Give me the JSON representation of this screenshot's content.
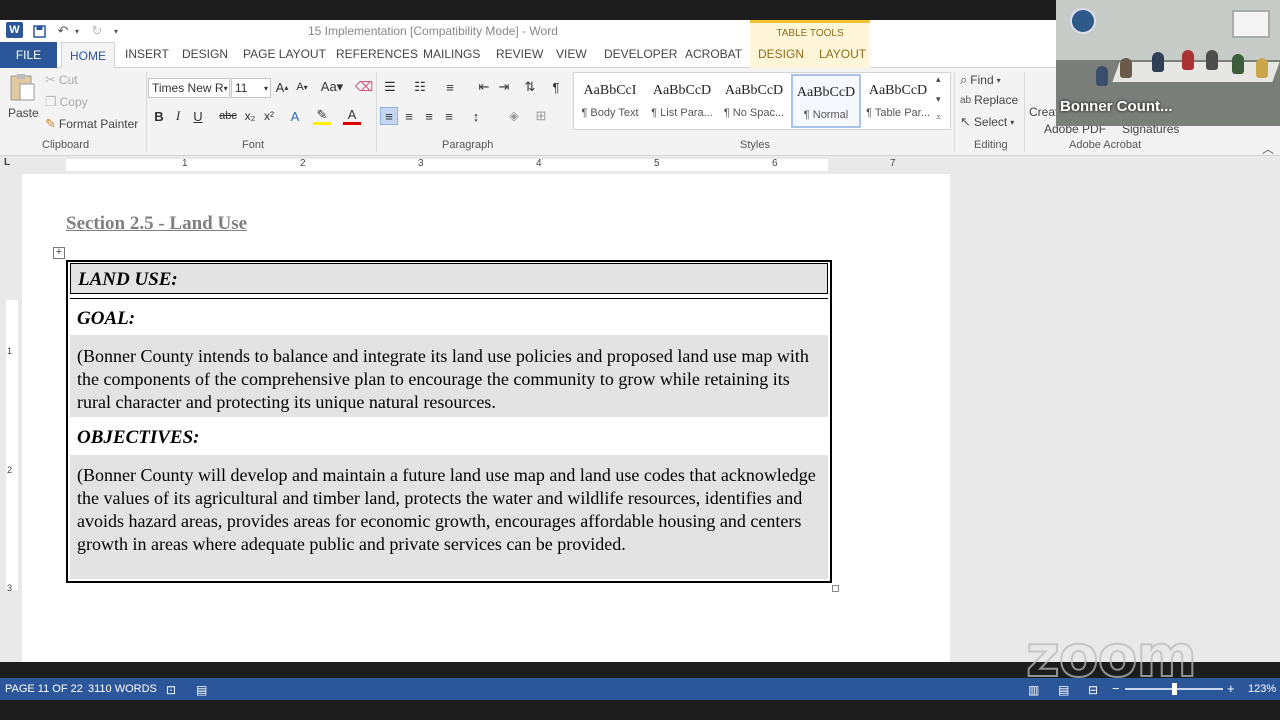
{
  "window": {
    "title": "15 Implementation [Compatibility Mode] - Word",
    "table_tools": "TABLE TOOLS"
  },
  "tabs": [
    "FILE",
    "HOME",
    "INSERT",
    "DESIGN",
    "PAGE LAYOUT",
    "REFERENCES",
    "MAILINGS",
    "REVIEW",
    "VIEW",
    "DEVELOPER",
    "ACROBAT",
    "DESIGN",
    "LAYOUT"
  ],
  "clipboard": {
    "paste": "Paste",
    "cut": "Cut",
    "copy": "Copy",
    "format_painter": "Format Painter",
    "group": "Clipboard"
  },
  "font": {
    "name": "Times New R",
    "size": "11",
    "group": "Font"
  },
  "paragraph": {
    "group": "Paragraph"
  },
  "styles": {
    "group": "Styles",
    "items": [
      {
        "preview": "AaBbCcI",
        "name": "¶ Body Text"
      },
      {
        "preview": "AaBbCcD",
        "name": "¶ List Para..."
      },
      {
        "preview": "AaBbCcD",
        "name": "¶ No Spac..."
      },
      {
        "preview": "AaBbCcD",
        "name": "¶ Normal"
      },
      {
        "preview": "AaBbCcD",
        "name": "¶ Table Par..."
      }
    ]
  },
  "editing": {
    "find": "Find",
    "replace": "Replace",
    "select": "Select",
    "group": "Editing"
  },
  "acrobat": {
    "create": "Creat",
    "pdf": "Adobe PDF",
    "signatures": "Signatures",
    "group": "Adobe Acrobat"
  },
  "video": {
    "name": "Bonner Count..."
  },
  "ruler": {
    "h": [
      "1",
      "2",
      "3",
      "4",
      "5",
      "6",
      "7"
    ],
    "v": [
      "1",
      "2",
      "3"
    ]
  },
  "document": {
    "section_title": "Section 2.5 - Land Use",
    "table": {
      "land_use": "LAND USE:",
      "goal": "GOAL:",
      "goal_text": "(Bonner County intends to balance and integrate its land use policies and proposed land use map with the components of the comprehensive plan to encourage the community to grow while retaining its rural character and protecting its unique natural resources.",
      "objectives": "OBJECTIVES:",
      "objectives_text": "(Bonner County will develop and maintain a future land use map and land use codes that acknowledge the values of its agricultural and timber land, protects the water and wildlife resources, identifies and avoids hazard areas, provides areas for economic growth, encourages affordable housing and centers growth in areas where adequate public and private services can be provided."
    }
  },
  "status": {
    "page": "PAGE 11 OF 22",
    "words": "3110 WORDS",
    "zoom": "123%",
    "zoom_level": 0.5
  },
  "watermark": "zoom",
  "colors": {
    "word_blue": "#2b579a",
    "table_tools": "#f1c232",
    "cell_shade": "#e3e3e3"
  }
}
